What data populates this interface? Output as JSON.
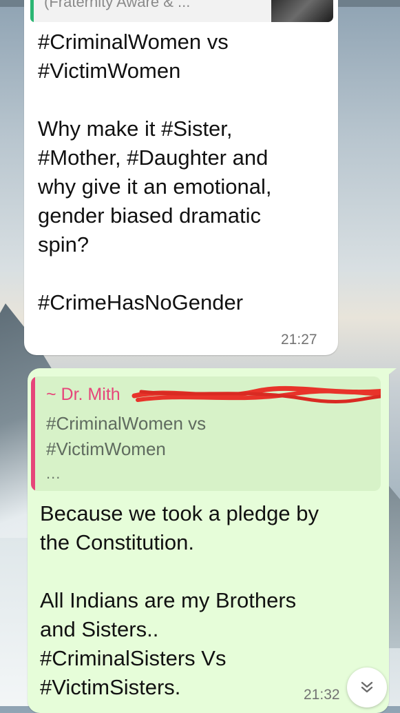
{
  "forwarded_header": {
    "text": "(Fraternity Aware & ..."
  },
  "incoming_message": {
    "text": "#CriminalWomen vs\n#VictimWomen\n\nWhy make it #Sister,\n#Mother, #Daughter and\nwhy give it an emotional,\ngender biased dramatic\nspin?\n\n#CrimeHasNoGender",
    "time": "21:27"
  },
  "outgoing_message": {
    "quote": {
      "author": "~ Dr. Mith",
      "text": "#CriminalWomen vs\n#VictimWomen",
      "more": "..."
    },
    "text": "Because we took a pledge by\nthe Constitution.\n\nAll Indians are my Brothers\nand Sisters..\n#CriminalSisters Vs\n#VictimSisters.",
    "time": "21:32"
  },
  "scroll_button": {
    "icon": "double-chevron-down-icon"
  },
  "colors": {
    "incoming_bubble": "#ffffff",
    "outgoing_bubble": "#e6fdd9",
    "quote_accent": "#e6457a",
    "forward_accent": "#2bb673",
    "redaction": "#e8332a"
  }
}
